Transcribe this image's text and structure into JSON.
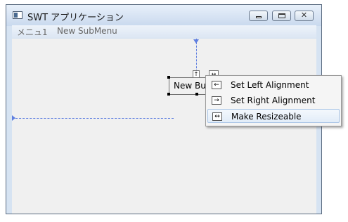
{
  "window": {
    "title": "SWT アプリケーション",
    "controls": {
      "minimize": "minimize",
      "maximize": "maximize",
      "close": "✕"
    }
  },
  "menubar": {
    "items": [
      "メニュ1",
      "New SubMenu"
    ]
  },
  "designer": {
    "button_label": "New Button",
    "mini_buttons": [
      "↑",
      "↔"
    ]
  },
  "context_menu": {
    "items": [
      {
        "icon": "←",
        "label": "Set Left Alignment"
      },
      {
        "icon": "→",
        "label": "Set Right Alignment"
      },
      {
        "icon": "↔",
        "label": "Make Resizeable"
      }
    ]
  },
  "colors": {
    "guide": "#5f7fe0",
    "menu_highlight": "#e2ecf8"
  },
  "icons": {
    "app": "window-icon",
    "alignment": [
      "arrow-left-icon",
      "arrow-right-icon",
      "resize-horizontal-icon"
    ]
  }
}
